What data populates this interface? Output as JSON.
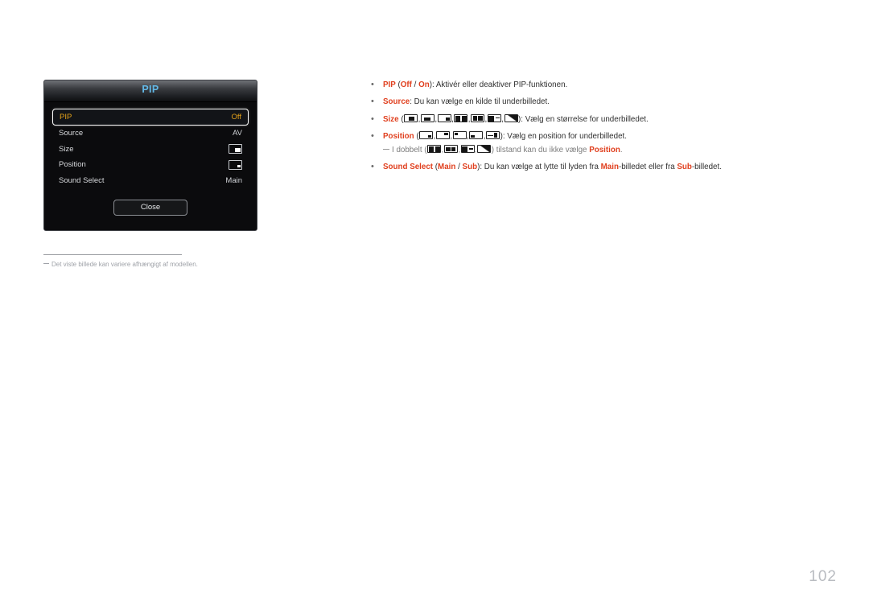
{
  "osd": {
    "title": "PIP",
    "rows": [
      {
        "label": "PIP",
        "value": "Off",
        "type": "text",
        "selected": true
      },
      {
        "label": "Source",
        "value": "AV",
        "type": "text",
        "selected": false
      },
      {
        "label": "Size",
        "value": "",
        "type": "icon-size",
        "selected": false
      },
      {
        "label": "Position",
        "value": "",
        "type": "icon-position",
        "selected": false
      },
      {
        "label": "Sound Select",
        "value": "Main",
        "type": "text",
        "selected": false
      }
    ],
    "close_label": "Close",
    "title_color": "#62b8e6",
    "highlight_color": "#e3a119"
  },
  "caption": {
    "text": "Det viste billede kan variere afhængigt af modellen."
  },
  "description": {
    "accent_color": "#e0401f",
    "bullet_glyph": "•",
    "items": [
      {
        "id": "pip",
        "parts": [
          {
            "t": "PIP",
            "style": "red"
          },
          {
            "t": " (",
            "style": "blk"
          },
          {
            "t": "Off",
            "style": "red"
          },
          {
            "t": " / ",
            "style": "blk"
          },
          {
            "t": "On",
            "style": "red"
          },
          {
            "t": "): Aktivér eller deaktiver PIP-funktionen.",
            "style": "blk"
          }
        ]
      },
      {
        "id": "source",
        "parts": [
          {
            "t": "Source",
            "style": "red"
          },
          {
            "t": ": Du kan vælge en kilde til underbilledet.",
            "style": "blk"
          }
        ]
      },
      {
        "id": "size",
        "parts": [
          {
            "t": "Size",
            "style": "red"
          },
          {
            "t": " (",
            "style": "blk"
          },
          {
            "t": "",
            "style": "icons",
            "icons": [
              "size-small-center",
              "size-medium-center",
              "size-small-right",
              "size-double-wide",
              "size-double-box",
              "size-double-line",
              "size-diagonal"
            ]
          },
          {
            "t": "): Vælg en størrelse for underbilledet.",
            "style": "blk"
          }
        ]
      },
      {
        "id": "position",
        "parts": [
          {
            "t": "Position",
            "style": "red"
          },
          {
            "t": " (",
            "style": "blk"
          },
          {
            "t": "",
            "style": "icons",
            "icons": [
              "pos-bottom-right",
              "pos-top-right",
              "pos-top-left",
              "pos-bottom-left",
              "pos-custom-arrow"
            ]
          },
          {
            "t": "): Vælg en position for underbilledet.",
            "style": "blk"
          }
        ]
      }
    ],
    "subnote": {
      "lead": "I dobbelt (",
      "icons": [
        "size-double-wide",
        "size-double-box",
        "size-double-line",
        "size-diagonal"
      ],
      "mid": ") tilstand kan du ikke vælge ",
      "accent": "Position",
      "tail": "."
    },
    "sound_select": {
      "parts": [
        {
          "t": "Sound Select",
          "style": "red"
        },
        {
          "t": " (",
          "style": "blk"
        },
        {
          "t": "Main",
          "style": "red"
        },
        {
          "t": " / ",
          "style": "blk"
        },
        {
          "t": "Sub",
          "style": "red"
        },
        {
          "t": "): Du kan vælge at lytte til lyden fra ",
          "style": "blk"
        },
        {
          "t": "Main",
          "style": "red"
        },
        {
          "t": "-billedet eller fra ",
          "style": "blk"
        },
        {
          "t": "Sub",
          "style": "red"
        },
        {
          "t": "-billedet.",
          "style": "blk"
        }
      ]
    }
  },
  "page": {
    "number": "102"
  }
}
